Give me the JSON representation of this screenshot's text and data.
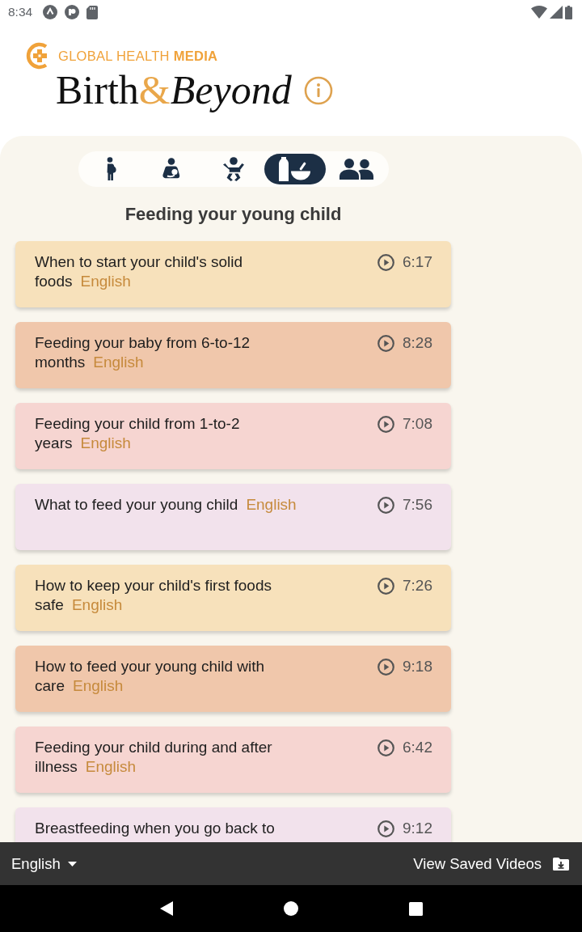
{
  "status_bar": {
    "time": "8:34"
  },
  "header": {
    "brand": "GLOBAL HEALTH **MEDIA**",
    "app_title": [
      "Birth",
      "&",
      "Beyond"
    ]
  },
  "tabs": [
    {
      "selected": false
    },
    {
      "selected": false
    },
    {
      "selected": false
    },
    {
      "selected": true
    },
    {
      "selected": false
    }
  ],
  "section_title": "Feeding your young child",
  "videos": [
    {
      "title": "When to start your child's solid foods",
      "language": "English",
      "duration": "6:17",
      "color": "#f7e1bb"
    },
    {
      "title": "Feeding your baby from 6-to-12 months",
      "language": "English",
      "duration": "8:28",
      "color": "#f0c7ab"
    },
    {
      "title": "Feeding your child from 1-to-2 years",
      "language": "English",
      "duration": "7:08",
      "color": "#f6d5d1"
    },
    {
      "title": "What to feed your young child",
      "language": "English",
      "duration": "7:56",
      "color": "#f2e2ec"
    },
    {
      "title": "How to keep your child's first foods safe",
      "language": "English",
      "duration": "7:26",
      "color": "#f7e1bb"
    },
    {
      "title": "How to feed your young child with care",
      "language": "English",
      "duration": "9:18",
      "color": "#f0c7ab"
    },
    {
      "title": "Feeding your child during and after illness",
      "language": "English",
      "duration": "6:42",
      "color": "#f6d5d1"
    },
    {
      "title": "Breastfeeding when you go back to",
      "duration": "9:12",
      "color": "#f2e2ec"
    }
  ],
  "bottom_bar": {
    "language": "English",
    "saved_videos": "View Saved Videos"
  }
}
